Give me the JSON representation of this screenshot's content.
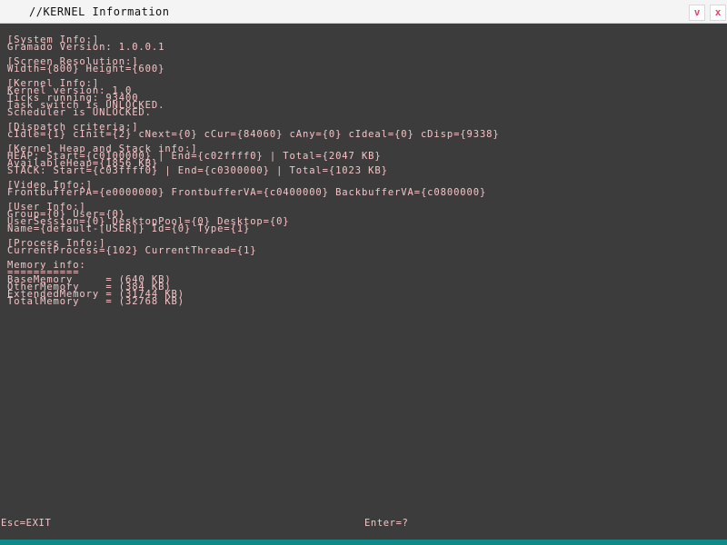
{
  "window": {
    "title": "//KERNEL Information",
    "minimize_label": "v",
    "close_label": "x"
  },
  "content": {
    "lines": [
      "[System Info:]",
      "Gramado Version: 1.0.0.1",
      "",
      "[Screen Resolution:]",
      "Width={800} Height={600}",
      "",
      "[Kernel Info:]",
      "Kernel version: 1.0",
      "Ticks running: 93400",
      "Task switch is UNLOCKED.",
      "Scheduler is UNLOCKED.",
      "",
      "[Dispatch criteria:]",
      "cIdle={1} cInit={2} cNext={0} cCur={84060} cAny={0} cIdeal={0} cDisp={9338}",
      "",
      "[Kernel Heap and Stack info:]",
      "HEAP: Start={c0100000} | End={c02ffff0} | Total={2047 KB}",
      "AvailableHeap={1856 KB}",
      "STACK: Start={c03ffff0} | End={c0300000} | Total={1023 KB}",
      "",
      "[Video Info:]",
      "FrontbufferPA={e0000000} FrontbufferVA={c0400000} BackbufferVA={c0800000}",
      "",
      "[User Info:]",
      "Group={0} User={0}",
      "UserSession={0} DesktopPool={0} Desktop={0}",
      "Name={default-[USER]} Id={0} Type={1}",
      "",
      "[Process Info:]",
      "CurrentProcess={102} CurrentThread={1}",
      "",
      "Memory info:",
      "===========",
      "BaseMemory     = (640 KB)",
      "OtherMemory    = (384 KB)",
      "ExtendedMemory = (31744 KB)",
      "TotalMemory    = (32768 KB)"
    ]
  },
  "footer": {
    "left": "Esc=EXIT",
    "right": "Enter=?"
  },
  "colors": {
    "background": "#3c3c3c",
    "text": "#f6c4c7",
    "titlebar": "#f4f4f4",
    "taskbar": "#0f8a8a"
  }
}
